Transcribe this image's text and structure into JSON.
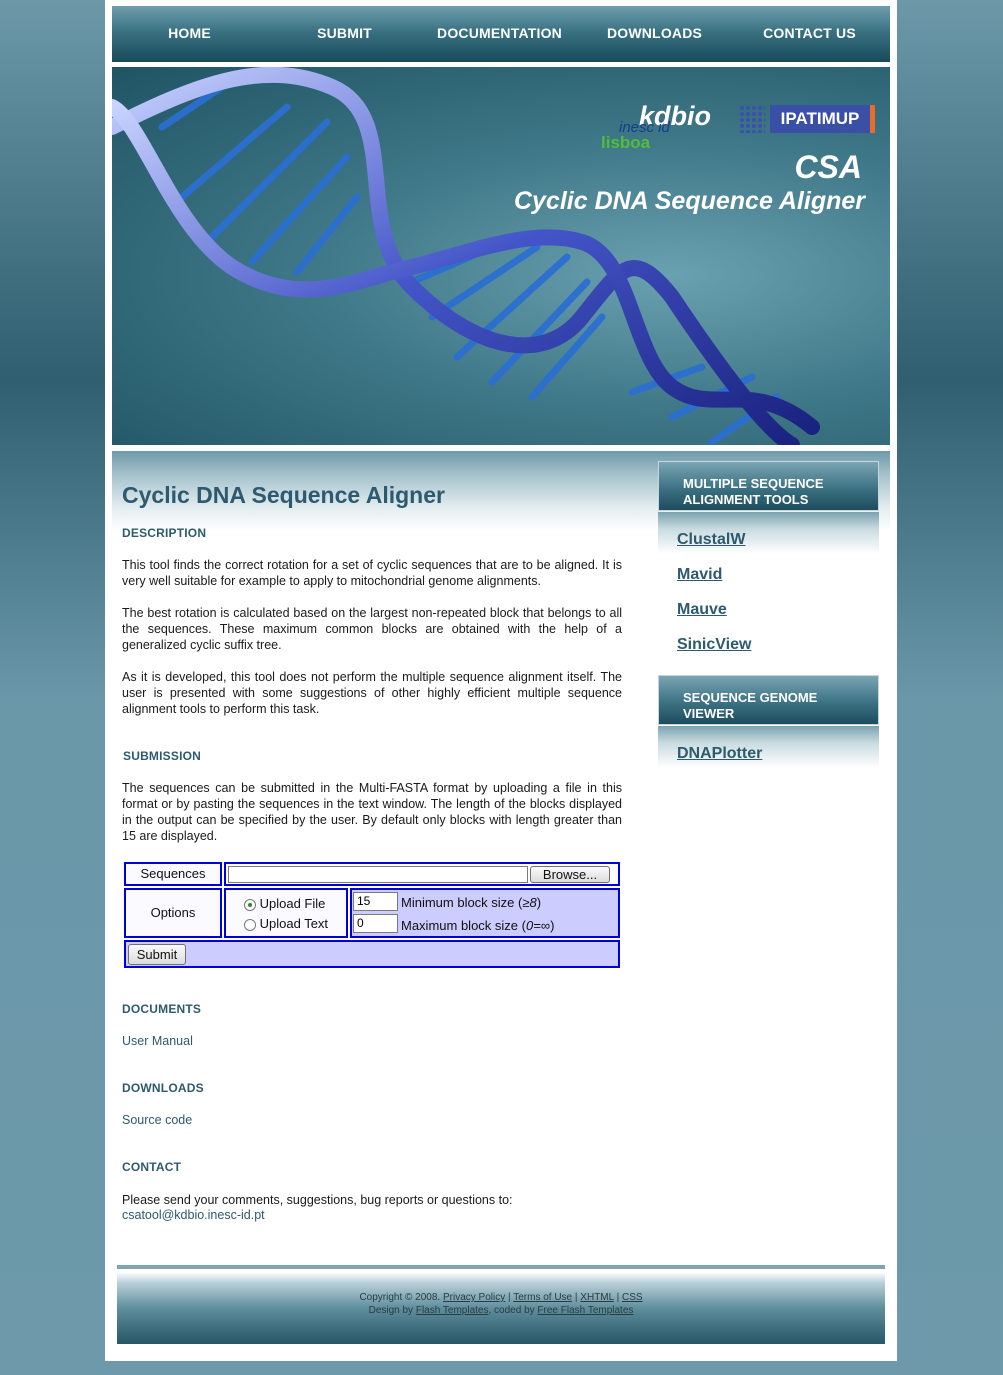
{
  "nav": {
    "home": "HOME",
    "submit": "SUBMIT",
    "documentation": "DOCUMENTATION",
    "downloads": "DOWNLOADS",
    "contact": "CONTACT US"
  },
  "banner": {
    "kdbio": "kdbio",
    "inesc": "inesc id",
    "lisboa": "lisboa",
    "ipatimup": "IPATIMUP",
    "csa": "CSA",
    "subtitle": "Cyclic DNA Sequence Aligner"
  },
  "main": {
    "title": "Cyclic DNA Sequence Aligner",
    "description_heading": "DESCRIPTION",
    "description_p1": "This tool finds the correct rotation for a set of cyclic sequences that are to be aligned. It is very well suitable for example to apply to mitochondrial genome alignments.",
    "description_p2": "The best rotation is calculated based on the largest non-repeated block that belongs to all the sequences. These maximum common blocks are obtained with the help of a generalized cyclic suffix tree.",
    "description_p3": "As it is developed, this tool does not perform the multiple sequence alignment itself. The user is presented with some suggestions of other highly efficient multiple sequence alignment tools to perform this task.",
    "submission_heading": "SUBMISSION",
    "submission_p": "The sequences can be submitted in the Multi-FASTA format by uploading a file in this format or by pasting the sequences in the text window. The length of the blocks displayed in the output can be specified by the user. By default only blocks with length greater than 15 are displayed.",
    "documents_heading": "DOCUMENTS",
    "user_manual": "User Manual",
    "downloads_heading": "DOWNLOADS",
    "source_code": "Source code",
    "contact_heading": "CONTACT",
    "contact_p": "Please send your comments, suggestions, bug reports or questions to:",
    "contact_email": "csatool@kdbio.inesc-id.pt"
  },
  "form": {
    "sequences_label": "Sequences",
    "file_value": "",
    "browse": "Browse...",
    "options_label": "Options",
    "upload_file": "Upload File",
    "upload_text": "Upload Text",
    "selected_mode": "Upload File",
    "min_value": "15",
    "min_label": "Minimum block size (",
    "min_label_sym": "≥8",
    "min_label_end": ")",
    "max_value": "0",
    "max_label": "Maximum block size (",
    "max_label_sym": "0=∞",
    "max_label_end": ")",
    "submit": "Submit"
  },
  "sidebar": {
    "msa_heading_1": "MULTIPLE SEQUENCE",
    "msa_heading_2": "ALIGNMENT TOOLS",
    "links": [
      "ClustalW",
      "Mavid",
      "Mauve",
      "SinicView"
    ],
    "viewer_heading_1": "SEQUENCE GENOME",
    "viewer_heading_2": "VIEWER",
    "viewer_link": "DNAPlotter"
  },
  "footer": {
    "copyright": "Copyright © 2008.",
    "privacy": "Privacy Policy",
    "terms": "Terms of Use",
    "xhtml": "XHTML",
    "css": "CSS",
    "design_by": "Design by",
    "flash_templates": "Flash Templates",
    "coded_by": ", coded by",
    "free_flash": "Free Flash Templates",
    "sep": "|"
  },
  "colors": {
    "accent": "#2d5a6e",
    "nav_dark": "#184a5a",
    "form_border": "#0000d8",
    "form_fill": "#ccccff"
  }
}
